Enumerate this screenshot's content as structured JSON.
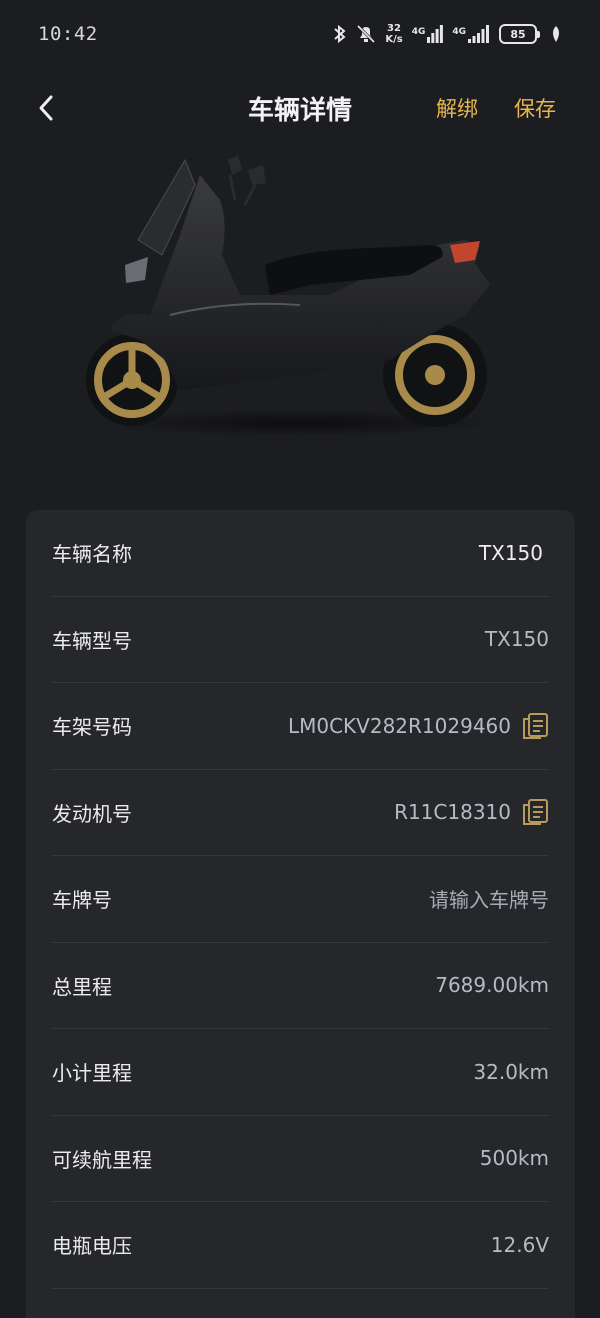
{
  "status_bar": {
    "time": "10:42",
    "speed_value": "32",
    "speed_unit": "K/s",
    "net1": "4G",
    "net2": "4G",
    "battery": "85"
  },
  "header": {
    "title": "车辆详情",
    "unbind_label": "解绑",
    "save_label": "保存"
  },
  "colors": {
    "accent": "#e8b64c",
    "background": "#1c1d20",
    "card": "#26272b"
  },
  "details": {
    "name": {
      "label": "车辆名称",
      "value": "TX150"
    },
    "model": {
      "label": "车辆型号",
      "value": "TX150"
    },
    "frame": {
      "label": "车架号码",
      "value": "LM0CKV282R1029460"
    },
    "engine": {
      "label": "发动机号",
      "value": "R11C18310"
    },
    "plate": {
      "label": "车牌号",
      "placeholder": "请输入车牌号"
    },
    "total_mileage": {
      "label": "总里程",
      "value": "7689.00km"
    },
    "trip_mileage": {
      "label": "小计里程",
      "value": "32.0km"
    },
    "range": {
      "label": "可续航里程",
      "value": "500km"
    },
    "battery_voltage": {
      "label": "电瓶电压",
      "value": "12.6V"
    }
  }
}
